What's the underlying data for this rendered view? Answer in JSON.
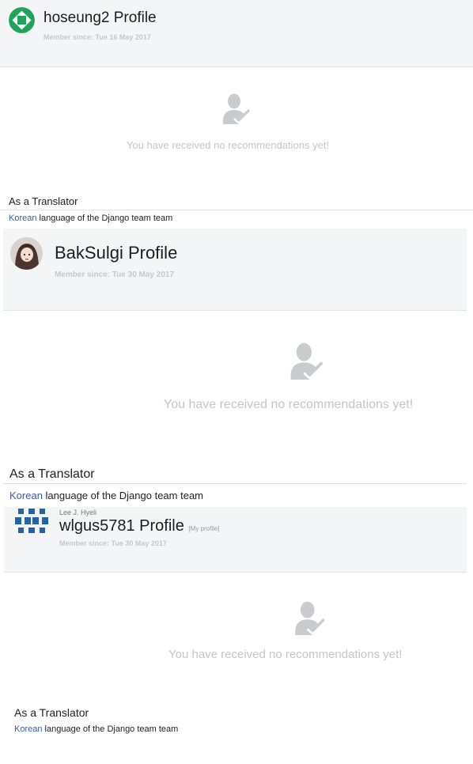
{
  "profiles": [
    {
      "title": "hoseung2 Profile",
      "member_since_label": "Member since:",
      "member_since_date": "Tue 16 May 2017",
      "empty_message": "You have received no recommendations yet!",
      "role_heading": "As a Translator",
      "language_link": "Korean",
      "language_suffix": " language of the Django team team"
    },
    {
      "title": "BakSulgi Profile",
      "member_since_label": "Member since:",
      "member_since_date": "Tue 30 May 2017",
      "empty_message": "You have received no recommendations yet!",
      "role_heading": "As a Translator",
      "language_link": "Korean",
      "language_suffix": " language of the Django team team"
    },
    {
      "real_name": "Lee J. Hyeli",
      "title": "wlgus5781 Profile",
      "my_profile_tag": "[My profile]",
      "member_since_label": "Member since:",
      "member_since_date": "Tue 30 May 2017",
      "empty_message": "You have received no recommendations yet!",
      "role_heading": "As a Translator",
      "language_link": "Korean",
      "language_suffix": " language of the Django team team"
    }
  ],
  "colors": {
    "header_bg": "#f4f5f6",
    "muted_text": "#c4c6c9",
    "link": "#3b5bab",
    "avatar_green": "#1fa35a",
    "avatar_blue": "#2563a8"
  },
  "icons": [
    "green-geometric-avatar-icon",
    "photo-avatar",
    "blue-grid-avatar-icon",
    "user-check-icon"
  ]
}
